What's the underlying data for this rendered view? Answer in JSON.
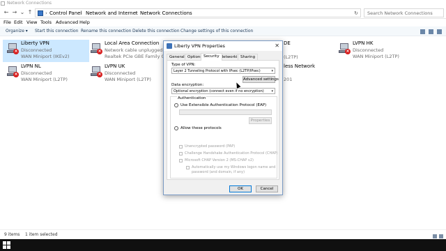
{
  "window": {
    "title": "Network Connections"
  },
  "address": {
    "crumbs": [
      "Control Panel",
      "Network and Internet",
      "Network Connections"
    ],
    "separator": "›",
    "search_placeholder": "Search Network Connections"
  },
  "menu": [
    "File",
    "Edit",
    "View",
    "Tools",
    "Advanced",
    "Help"
  ],
  "commands": [
    "Organize ▾",
    "Start this connection",
    "Rename this connection",
    "Delete this connection",
    "Change settings of this connection"
  ],
  "connections": [
    {
      "name": "Liberty VPN",
      "status": "Disconnected",
      "device": "WAN Miniport (IKEv2)"
    },
    {
      "name": "Local Area Connection",
      "status": "Network cable unplugged",
      "device": "Realtek PCIe GBE Family C..."
    },
    {
      "name": "LVPN HK",
      "status": "Disconnected",
      "device": "WAN Miniport (L2TP)"
    },
    {
      "name": "LVPN NL",
      "status": "Disconnected",
      "device": "WAN Miniport (L2TP)"
    },
    {
      "name": "LVPN UK",
      "status": "Disconnected",
      "device": "WAN Miniport (L2TP)"
    }
  ],
  "partial_texts": {
    "de_name": "DE",
    "de_device": "(L2TP)",
    "wireless_name": "less Network",
    "wireless_device": "201"
  },
  "status": {
    "items": "9 items",
    "selected": "1 item selected"
  },
  "dialog": {
    "title": "Liberty VPN Properties",
    "close": "✕",
    "tabs": [
      "General",
      "Options",
      "Security",
      "Networking",
      "Sharing"
    ],
    "active_tab": "Security",
    "type_label": "Type of VPN:",
    "type_value": "Layer 2 Tunneling Protocol with IPsec (L2TP/IPsec)",
    "advanced_button": "Advanced settings",
    "encryption_label": "Data encryption:",
    "encryption_value": "Optional encryption (connect even if no encryption)",
    "auth_group": "Authentication",
    "eap_label": "Use Extensible Authentication Protocol (EAP)",
    "properties_button": "Properties",
    "allow_label": "Allow these protocols",
    "protocols": [
      "Unencrypted password (PAP)",
      "Challenge Handshake Authentication Protocol (CHAP)",
      "Microsoft CHAP Version 2 (MS-CHAP v2)"
    ],
    "auto_windows_line1": "Automatically use my Windows logon name and",
    "auto_windows_line2": "password (and domain, if any)",
    "ok": "OK",
    "cancel": "Cancel"
  }
}
